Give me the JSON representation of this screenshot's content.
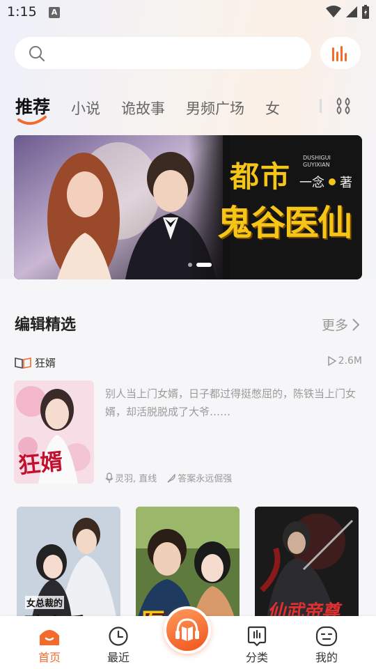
{
  "status_bar": {
    "time": "1:15",
    "badge": "A"
  },
  "search": {
    "placeholder": ""
  },
  "tabs": [
    {
      "label": "推荐",
      "active": true
    },
    {
      "label": "小说"
    },
    {
      "label": "诡故事"
    },
    {
      "label": "男频广场"
    },
    {
      "label": "女"
    }
  ],
  "banner": {
    "title_line1": "都市",
    "title_line2": "鬼谷医仙",
    "pinyin_line1": "DUSHIGUI",
    "pinyin_line2": "GUYIXIAN",
    "author": "一念",
    "author_suffix": "著"
  },
  "section": {
    "title": "编辑精选",
    "more": "更多"
  },
  "featured": {
    "name": "狂婿",
    "plays": "2.6M",
    "desc": "别人当上门女婿，日子都过得挺憋屈的，陈铁当上门女婿，却活脱脱成了大爷……",
    "narrator": "灵羽, 直线",
    "author": "答案永远倔强",
    "cover_title": "狂婿"
  },
  "covers": [
    {
      "text": "女总裁的",
      "big": "贴身兵王"
    },
    {
      "text": "",
      "big": "医王"
    },
    {
      "text": "",
      "big": "仙武帝尊"
    }
  ],
  "nav": {
    "home": "首页",
    "recent": "最近",
    "category": "分类",
    "mine": "我的"
  },
  "colors": {
    "accent": "#f26a2c"
  }
}
